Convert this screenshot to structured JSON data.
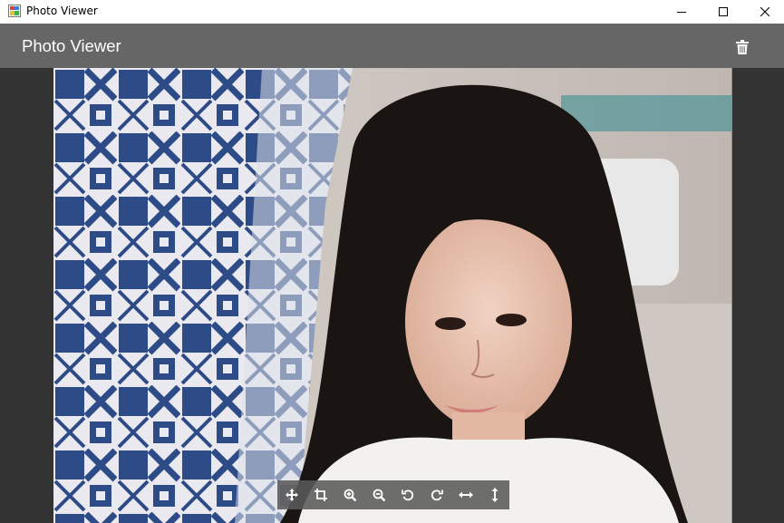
{
  "window": {
    "title": "Photo Viewer",
    "controls": [
      "minimize",
      "maximize",
      "close"
    ]
  },
  "header": {
    "title": "Photo Viewer",
    "delete_icon": "trash-icon"
  },
  "toolbar": {
    "tools": [
      {
        "name": "move",
        "icon": "move-icon"
      },
      {
        "name": "crop",
        "icon": "crop-icon"
      },
      {
        "name": "zoom-in",
        "icon": "zoom-in-icon"
      },
      {
        "name": "zoom-out",
        "icon": "zoom-out-icon"
      },
      {
        "name": "rotate-left",
        "icon": "rotate-left-icon"
      },
      {
        "name": "rotate-right",
        "icon": "rotate-right-icon"
      },
      {
        "name": "flip-horizontal",
        "icon": "flip-horizontal-icon"
      },
      {
        "name": "flip-vertical",
        "icon": "flip-vertical-icon"
      }
    ]
  },
  "colors": {
    "header_bg": "#666666",
    "viewer_bg": "#333333",
    "toolbar_bg": "#5a5a5a",
    "selection_border": "#2ecc40"
  }
}
